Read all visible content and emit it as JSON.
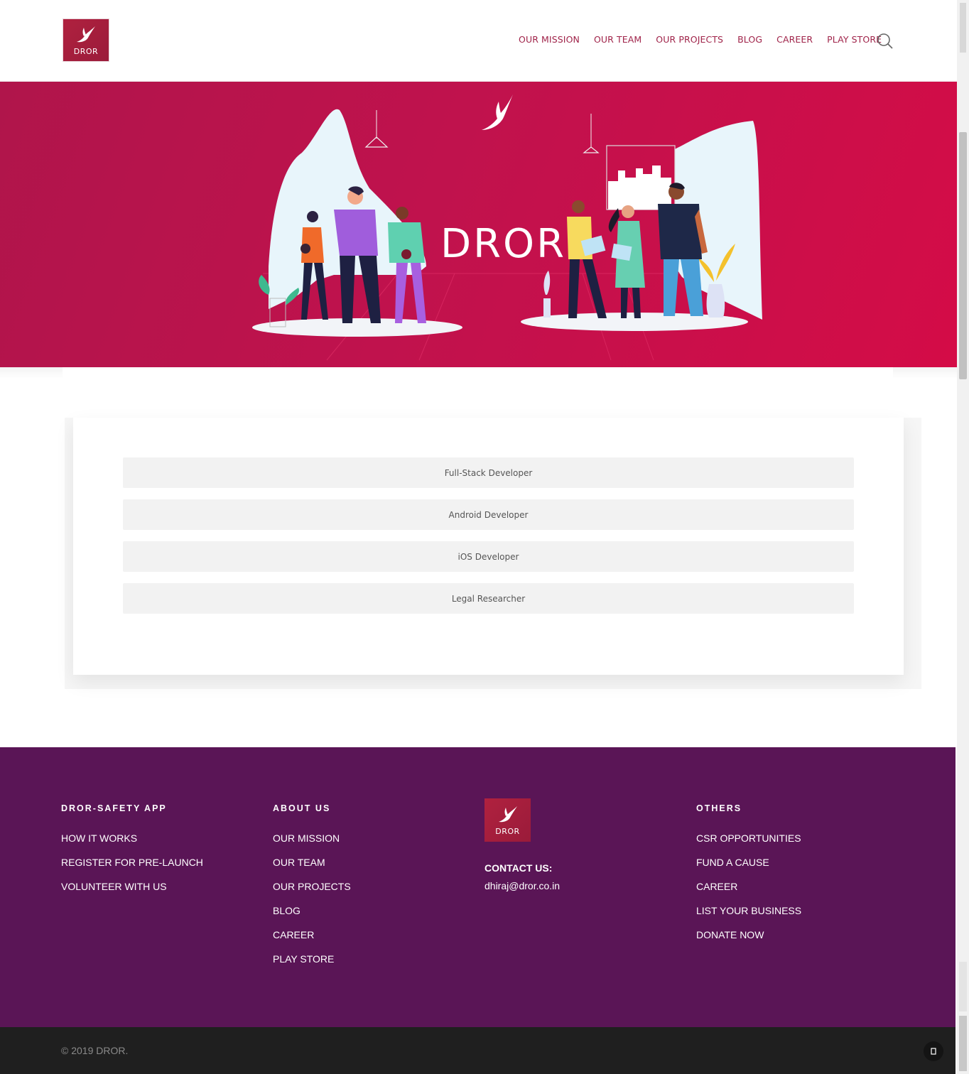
{
  "brand": {
    "logo_text": "DROR",
    "hero_title": "DROR",
    "accent": "#a0244a",
    "hero_color": "#c8124c",
    "footer_color": "#5a1556"
  },
  "nav": [
    "OUR MISSION",
    "OUR TEAM",
    "OUR PROJECTS",
    "BLOG",
    "CAREER",
    "PLAY STORE"
  ],
  "jobs": [
    "Full-Stack Developer",
    "Android Developer",
    "iOS Developer",
    "Legal Researcher"
  ],
  "footer": {
    "col1": {
      "heading": "DROR-SAFETY APP",
      "links": [
        "HOW IT WORKS",
        "REGISTER FOR PRE-LAUNCH",
        "VOLUNTEER WITH US"
      ]
    },
    "col2": {
      "heading": "ABOUT US",
      "links": [
        "OUR MISSION",
        "OUR TEAM",
        "OUR PROJECTS",
        "BLOG",
        "CAREER",
        "PLAY STORE"
      ]
    },
    "col3": {
      "logo_text": "DROR",
      "contact_label": "CONTACT US:",
      "email": "dhiraj@dror.co.in"
    },
    "col4": {
      "heading": "OTHERS",
      "links": [
        "CSR OPPORTUNITIES",
        "FUND A CAUSE",
        "CAREER",
        "LIST YOUR BUSINESS",
        "DONATE NOW"
      ]
    }
  },
  "copyright": "© 2019 DROR.",
  "scroll_top_icon": "chevron-up-icon"
}
